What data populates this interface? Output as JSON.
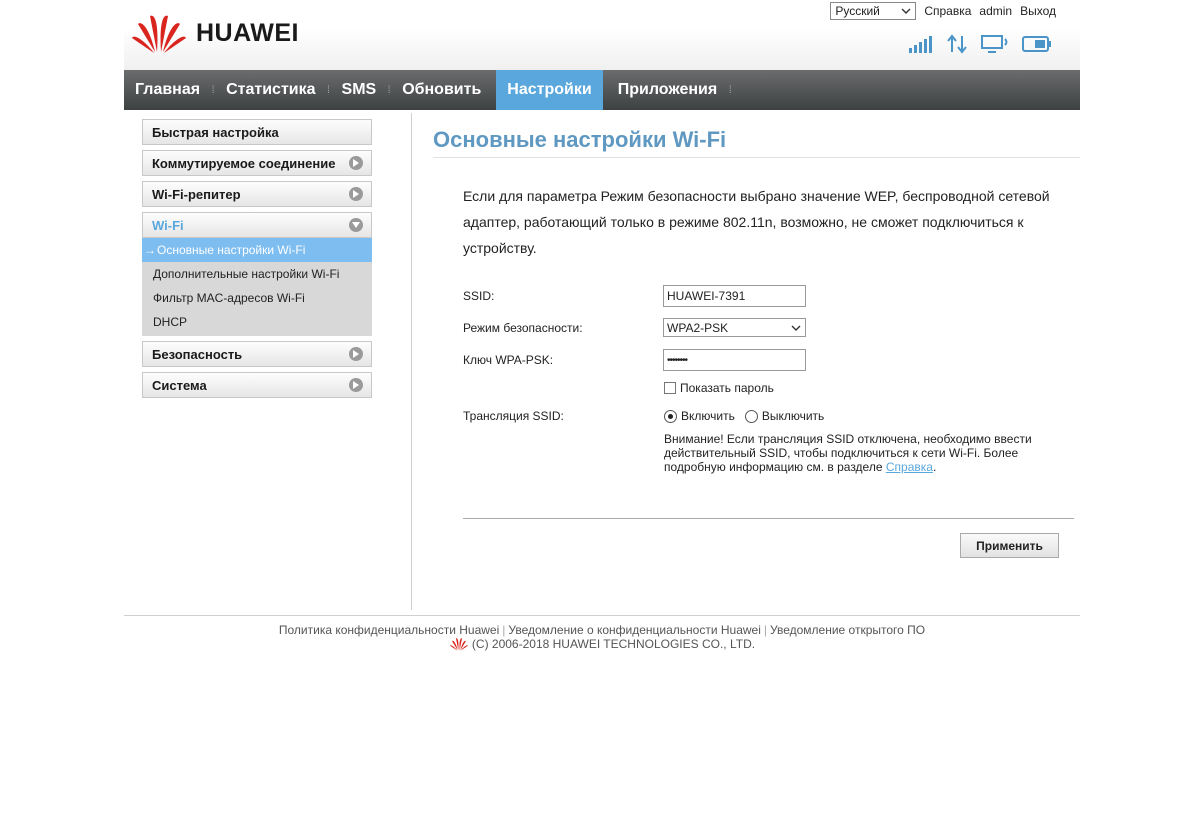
{
  "header": {
    "brand": "HUAWEI",
    "language": "Русский",
    "help_link": "Справка",
    "user": "admin",
    "logout_link": "Выход"
  },
  "icons": {
    "signal": "signal-strength-icon",
    "traffic": "up-down-traffic-icon",
    "connection": "monitor-wifi-icon",
    "battery": "battery-icon"
  },
  "nav": {
    "items": [
      "Главная",
      "Статистика",
      "SMS",
      "Обновить",
      "Настройки",
      "Приложения"
    ],
    "active": "Настройки"
  },
  "sidebar": {
    "quick_setup": "Быстрая настройка",
    "dialup": "Коммутируемое соединение",
    "repeater": "Wi-Fi-репитер",
    "wifi": "Wi-Fi",
    "wifi_sub": [
      "Основные настройки Wi-Fi",
      "Дополнительные настройки Wi-Fi",
      "Фильтр MAC-адресов Wi-Fi",
      "DHCP"
    ],
    "security": "Безопасность",
    "system": "Система"
  },
  "main": {
    "title": "Основные настройки Wi-Fi",
    "notice": "Если для параметра Режим безопасности выбрано значение WEP, беспроводной сетевой адаптер, работающий только в режиме 802.11n, возможно, не сможет подключиться к устройству.",
    "ssid_label": "SSID:",
    "ssid_value": "HUAWEI-7391",
    "mode_label": "Режим безопасности:",
    "mode_value": "WPA2-PSK",
    "key_label": "Ключ WPA-PSK:",
    "key_value": "••••••••",
    "show_password": "Показать пароль",
    "broadcast_label": "Трансляция SSID:",
    "enable": "Включить",
    "disable": "Выключить",
    "warning": "Внимание! Если трансляция SSID отключена, необходимо ввести действительный SSID, чтобы подключиться к сети Wi-Fi. Более подробную информацию см. в разделе",
    "warning_link": "Справка",
    "apply": "Применить"
  },
  "footer": {
    "privacy": "Политика конфиденциальности Huawei",
    "privacy_notice": "Уведомление о конфиденциальности Huawei",
    "oss": "Уведомление открытого ПО",
    "copyright": "(C) 2006-2018 HUAWEI TECHNOLOGIES CO., LTD."
  },
  "colors": {
    "accent": "#5aa7dd",
    "title": "#5f98c1",
    "nav_bg": "#4a4d4e",
    "logo_red": "#d9251d"
  }
}
